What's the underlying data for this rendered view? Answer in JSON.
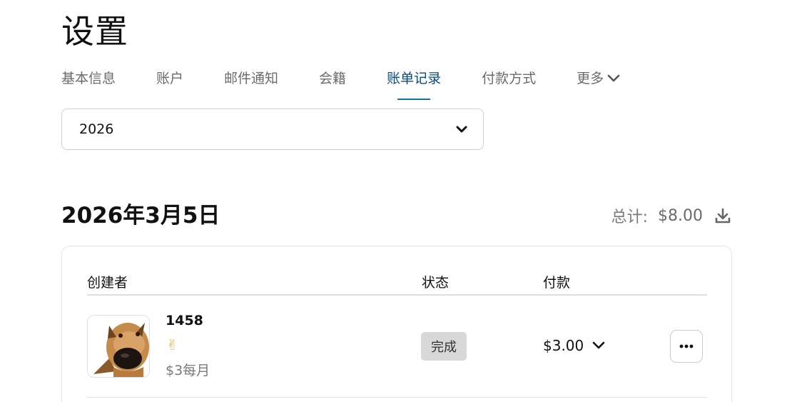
{
  "page": {
    "title": "设置"
  },
  "tabs": [
    {
      "label": "基本信息",
      "active": false
    },
    {
      "label": "账户",
      "active": false
    },
    {
      "label": "邮件通知",
      "active": false
    },
    {
      "label": "会籍",
      "active": false
    },
    {
      "label": "账单记录",
      "active": true
    },
    {
      "label": "付款方式",
      "active": false
    },
    {
      "label": "更多",
      "active": false,
      "icon": "chevron-down-icon"
    }
  ],
  "year_select": {
    "value": "2026",
    "icon": "chevron-down-icon"
  },
  "billing_group": {
    "date": "2026年3月5日",
    "total_label": "总计:",
    "total_amount": "$8.00",
    "download_icon": "download-icon"
  },
  "table": {
    "headers": {
      "creator": "创建者",
      "status": "状态",
      "payment": "付款"
    },
    "rows": [
      {
        "creator_name": "1458",
        "tier_emoji": "✌",
        "tier_price": "$3每月",
        "status": "完成",
        "payment": "$3.00",
        "avatar": "dog-avatar"
      }
    ]
  },
  "colors": {
    "active_tab": "#0e4a73",
    "active_underline": "#1a6fa0",
    "status_badge_bg": "#d8d8d8"
  }
}
